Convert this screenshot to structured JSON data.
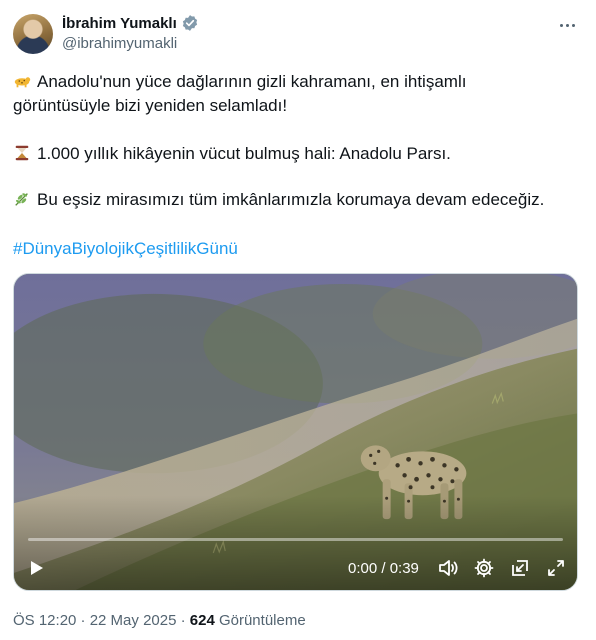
{
  "author": {
    "name": "İbrahim Yumaklı",
    "handle": "@ibrahimyumakli",
    "verified": true
  },
  "tweet": {
    "line1": "Anadolu'nun yüce dağlarının gizli kahramanı, en ihtişamlı",
    "line2": "görüntüsüyle bizi yeniden selamladı!",
    "line3": "1.000 yıllık hikâyenin vücut bulmuş hali: Anadolu Parsı.",
    "line4": "Bu eşsiz mirasımızı tüm imkânlarımızla korumaya devam edeceğiz.",
    "hashtag": "#DünyaBiyolojikÇeşitlilikGünü",
    "emojis": [
      "leopard-emoji",
      "hourglass-emoji",
      "herb-emoji"
    ]
  },
  "video": {
    "time": "0:00 / 0:39",
    "progress": 0.0
  },
  "meta": {
    "timestamp": "ÖS 12:20 · 22 May 2025 · ",
    "views_count": "624",
    "views_label": " Görüntüleme"
  },
  "colors": {
    "link": "#1d9bf0",
    "verified": "#829aab",
    "secondary_text": "#536471"
  }
}
